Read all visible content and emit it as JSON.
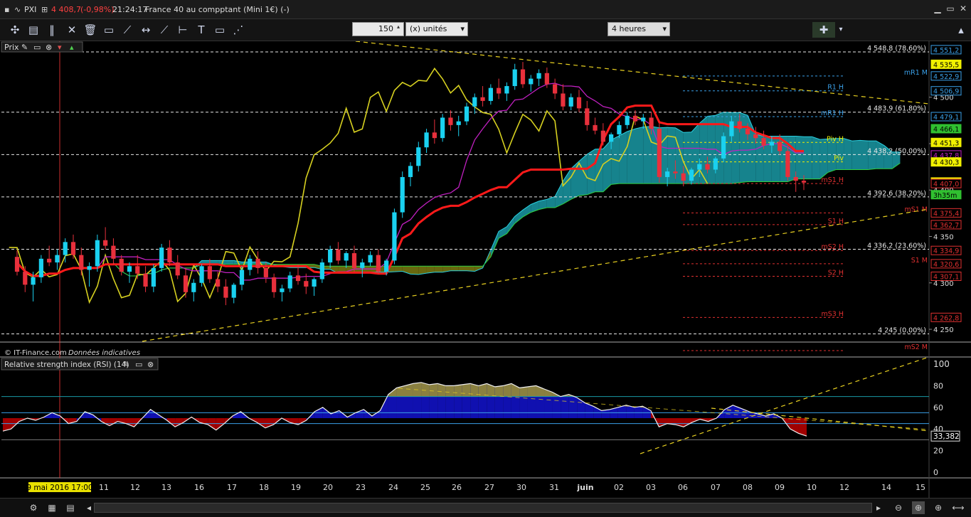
{
  "window": {
    "symbol": "PXI",
    "price": "4 408,7",
    "change": "(-0,98%)",
    "time": "21:24:17",
    "instrument": "France 40 au compptant (Mini 1€) (-)"
  },
  "toolbar": {
    "units_value": "150",
    "units_label": "(x) unités",
    "period_label": "4 heures"
  },
  "price_panel": {
    "label": "Prix",
    "source_label": "© IT-Finance.com",
    "source_note": "Données indicatives"
  },
  "rsi_panel": {
    "label": "Relative strength index (RSI) (14)",
    "value_tag": "33,382"
  },
  "colors": {
    "bull": "#1ad1f0",
    "bear": "#e8303c",
    "kijun": "#ff1a1a",
    "tenkan": "#c020c0",
    "chikou": "#d6d020",
    "cloud_bear": "#7a7a10",
    "cloud_bull": "#1a9aa6",
    "rsi_high": "#1010b0",
    "rsi_low": "#a00000"
  },
  "chart_data": {
    "type": "candlestick",
    "price_axis_ticks": [
      "4 500",
      "4 450",
      "4 400",
      "4 350",
      "4 300",
      "4 250"
    ],
    "price_tags": [
      {
        "text": "4 551,2",
        "price": 4551.2,
        "color": "#3aa0e8"
      },
      {
        "text": "4 535,5",
        "price": 4535.5,
        "color": "#f0f000"
      },
      {
        "text": "4 522,9",
        "price": 4522.9,
        "color": "#3aa0e8"
      },
      {
        "text": "4 506,9",
        "price": 4506.9,
        "color": "#3aa0e8"
      },
      {
        "text": "4 479,1",
        "price": 4479.1,
        "color": "#3aa0e8"
      },
      {
        "text": "4 466,1",
        "price": 4466.1,
        "color": "#30c030"
      },
      {
        "text": "4 451,3",
        "price": 4451.3,
        "color": "#f0f000"
      },
      {
        "text": "4 437,8",
        "price": 4437.8,
        "color": "#c020c0"
      },
      {
        "text": "4 430,3",
        "price": 4430.3,
        "color": "#f0f000"
      },
      {
        "text": "4 408,7",
        "price": 4408.7,
        "color": "#f0e000"
      },
      {
        "text": "4 407,0",
        "price": 4407.0,
        "color": "#e03030"
      },
      {
        "text": "3h35m",
        "price": 4395.0,
        "color": "#30c030"
      },
      {
        "text": "4 375,4",
        "price": 4375.4,
        "color": "#e03030"
      },
      {
        "text": "4 362,7",
        "price": 4362.7,
        "color": "#e03030"
      },
      {
        "text": "4 334,9",
        "price": 4334.9,
        "color": "#e03030"
      },
      {
        "text": "4 320,6",
        "price": 4320.6,
        "color": "#e03030"
      },
      {
        "text": "4 307,1",
        "price": 4307.1,
        "color": "#e03030"
      },
      {
        "text": "4 262,8",
        "price": 4262.8,
        "color": "#e03030"
      }
    ],
    "fibo_levels": [
      {
        "label": "4 548,8 (78,60%)",
        "price": 4548.8
      },
      {
        "label": "4 483,9 (61,80%)",
        "price": 4483.9
      },
      {
        "label": "4 438,2 (50,00%)",
        "price": 4438.2
      },
      {
        "label": "4 392,6 (38,20%)",
        "price": 4392.6
      },
      {
        "label": "4 336,2 (23,60%)",
        "price": 4336.2
      },
      {
        "label": "4 245 (0,00%)",
        "price": 4245.0
      }
    ],
    "pivot_levels": [
      {
        "label": "mR1 M",
        "price": 4522.9,
        "color": "#3aa0e8"
      },
      {
        "label": "R1 H",
        "price": 4506.9,
        "color": "#3aa0e8"
      },
      {
        "label": "mR1 H",
        "price": 4479.1,
        "color": "#3aa0e8"
      },
      {
        "label": "Piv H",
        "price": 4451.3,
        "color": "#f0f000"
      },
      {
        "label": "Piv",
        "price": 4430.3,
        "color": "#f0f000"
      },
      {
        "label": "mS1 H",
        "price": 4407.0,
        "color": "#e03030"
      },
      {
        "label": "mS1 M",
        "price": 4375.4,
        "color": "#e03030"
      },
      {
        "label": "S1 H",
        "price": 4362.7,
        "color": "#e03030"
      },
      {
        "label": "mS2 H",
        "price": 4334.9,
        "color": "#e03030"
      },
      {
        "label": "S1 M",
        "price": 4320.6,
        "color": "#e03030"
      },
      {
        "label": "S2 H",
        "price": 4307.1,
        "color": "#e03030"
      },
      {
        "label": "mS3 H",
        "price": 4262.8,
        "color": "#e03030"
      },
      {
        "label": "mS2 M",
        "price": 4227.0,
        "color": "#e03030"
      }
    ],
    "x_labels": [
      "9 mai 2016 17:00",
      "11",
      "12",
      "13",
      "16",
      "17",
      "18",
      "19",
      "20",
      "23",
      "24",
      "25",
      "26",
      "27",
      "30",
      "31",
      "juin",
      "02",
      "03",
      "06",
      "07",
      "08",
      "09",
      "10",
      "12",
      "14",
      "15"
    ],
    "candles": [
      [
        4328,
        4335,
        4308,
        4312
      ],
      [
        4312,
        4318,
        4290,
        4298
      ],
      [
        4298,
        4312,
        4280,
        4306
      ],
      [
        4306,
        4330,
        4300,
        4326
      ],
      [
        4326,
        4340,
        4318,
        4322
      ],
      [
        4322,
        4336,
        4314,
        4330
      ],
      [
        4330,
        4348,
        4322,
        4344
      ],
      [
        4344,
        4352,
        4326,
        4330
      ],
      [
        4330,
        4338,
        4308,
        4314
      ],
      [
        4314,
        4322,
        4296,
        4318
      ],
      [
        4318,
        4352,
        4312,
        4346
      ],
      [
        4346,
        4360,
        4336,
        4340
      ],
      [
        4340,
        4348,
        4320,
        4326
      ],
      [
        4326,
        4330,
        4308,
        4312
      ],
      [
        4312,
        4322,
        4300,
        4318
      ],
      [
        4318,
        4330,
        4304,
        4310
      ],
      [
        4310,
        4318,
        4290,
        4296
      ],
      [
        4296,
        4320,
        4290,
        4316
      ],
      [
        4316,
        4342,
        4312,
        4338
      ],
      [
        4338,
        4346,
        4318,
        4322
      ],
      [
        4322,
        4330,
        4304,
        4308
      ],
      [
        4308,
        4316,
        4284,
        4290
      ],
      [
        4290,
        4304,
        4280,
        4300
      ],
      [
        4300,
        4320,
        4296,
        4318
      ],
      [
        4318,
        4326,
        4300,
        4304
      ],
      [
        4304,
        4312,
        4290,
        4296
      ],
      [
        4296,
        4304,
        4276,
        4284
      ],
      [
        4284,
        4300,
        4278,
        4298
      ],
      [
        4298,
        4318,
        4292,
        4314
      ],
      [
        4314,
        4330,
        4308,
        4326
      ],
      [
        4326,
        4334,
        4310,
        4316
      ],
      [
        4316,
        4322,
        4300,
        4306
      ],
      [
        4306,
        4310,
        4284,
        4290
      ],
      [
        4290,
        4298,
        4280,
        4294
      ],
      [
        4294,
        4312,
        4290,
        4308
      ],
      [
        4308,
        4320,
        4298,
        4302
      ],
      [
        4302,
        4310,
        4288,
        4296
      ],
      [
        4296,
        4306,
        4286,
        4304
      ],
      [
        4304,
        4326,
        4300,
        4322
      ],
      [
        4322,
        4340,
        4316,
        4336
      ],
      [
        4336,
        4344,
        4320,
        4324
      ],
      [
        4324,
        4334,
        4316,
        4332
      ],
      [
        4332,
        4340,
        4312,
        4316
      ],
      [
        4316,
        4326,
        4306,
        4322
      ],
      [
        4322,
        4334,
        4318,
        4330
      ],
      [
        4330,
        4336,
        4310,
        4312
      ],
      [
        4312,
        4326,
        4308,
        4324
      ],
      [
        4324,
        4380,
        4320,
        4376
      ],
      [
        4376,
        4420,
        4370,
        4414
      ],
      [
        4414,
        4430,
        4404,
        4426
      ],
      [
        4426,
        4452,
        4420,
        4446
      ],
      [
        4446,
        4466,
        4440,
        4462
      ],
      [
        4462,
        4476,
        4450,
        4456
      ],
      [
        4456,
        4482,
        4452,
        4478
      ],
      [
        4478,
        4486,
        4464,
        4470
      ],
      [
        4470,
        4480,
        4458,
        4474
      ],
      [
        4474,
        4494,
        4470,
        4490
      ],
      [
        4490,
        4504,
        4482,
        4500
      ],
      [
        4500,
        4512,
        4490,
        4496
      ],
      [
        4496,
        4514,
        4492,
        4510
      ],
      [
        4510,
        4520,
        4498,
        4504
      ],
      [
        4504,
        4516,
        4496,
        4512
      ],
      [
        4512,
        4536,
        4508,
        4530
      ],
      [
        4530,
        4538,
        4510,
        4514
      ],
      [
        4514,
        4524,
        4506,
        4520
      ],
      [
        4520,
        4530,
        4512,
        4526
      ],
      [
        4526,
        4532,
        4510,
        4514
      ],
      [
        4514,
        4520,
        4498,
        4504
      ],
      [
        4504,
        4514,
        4486,
        4490
      ],
      [
        4490,
        4504,
        4486,
        4500
      ],
      [
        4500,
        4508,
        4484,
        4488
      ],
      [
        4488,
        4496,
        4464,
        4470
      ],
      [
        4470,
        4478,
        4460,
        4464
      ],
      [
        4464,
        4472,
        4448,
        4452
      ],
      [
        4452,
        4462,
        4444,
        4460
      ],
      [
        4460,
        4474,
        4456,
        4470
      ],
      [
        4470,
        4484,
        4466,
        4480
      ],
      [
        4480,
        4486,
        4470,
        4474
      ],
      [
        4474,
        4482,
        4466,
        4478
      ],
      [
        4478,
        4484,
        4460,
        4466
      ],
      [
        4466,
        4472,
        4408,
        4414
      ],
      [
        4414,
        4424,
        4404,
        4420
      ],
      [
        4420,
        4432,
        4412,
        4418
      ],
      [
        4418,
        4426,
        4404,
        4410
      ],
      [
        4410,
        4424,
        4406,
        4422
      ],
      [
        4422,
        4434,
        4414,
        4428
      ],
      [
        4428,
        4436,
        4418,
        4422
      ],
      [
        4422,
        4436,
        4418,
        4434
      ],
      [
        4434,
        4462,
        4430,
        4458
      ],
      [
        4458,
        4480,
        4452,
        4474
      ],
      [
        4474,
        4482,
        4462,
        4466
      ],
      [
        4466,
        4472,
        4454,
        4460
      ],
      [
        4460,
        4468,
        4450,
        4456
      ],
      [
        4456,
        4464,
        4444,
        4448
      ],
      [
        4448,
        4458,
        4440,
        4452
      ],
      [
        4452,
        4460,
        4438,
        4442
      ],
      [
        4442,
        4448,
        4410,
        4414
      ],
      [
        4414,
        4420,
        4398,
        4410
      ],
      [
        4410,
        4416,
        4400,
        4408
      ]
    ],
    "rsi_axis_ticks": [
      "100",
      "80",
      "60",
      "40",
      "20",
      "0"
    ],
    "rsi_values": [
      38,
      40,
      47,
      50,
      48,
      51,
      55,
      52,
      45,
      47,
      56,
      53,
      47,
      43,
      47,
      45,
      42,
      50,
      58,
      53,
      48,
      42,
      46,
      51,
      46,
      44,
      39,
      45,
      52,
      56,
      50,
      46,
      41,
      44,
      50,
      46,
      44,
      48,
      56,
      60,
      54,
      57,
      51,
      55,
      58,
      52,
      57,
      72,
      78,
      80,
      82,
      83,
      81,
      82,
      80,
      80,
      81,
      82,
      80,
      82,
      79,
      80,
      82,
      78,
      79,
      80,
      77,
      74,
      70,
      72,
      69,
      64,
      61,
      57,
      58,
      60,
      62,
      60,
      61,
      57,
      42,
      45,
      44,
      42,
      46,
      49,
      47,
      50,
      58,
      62,
      59,
      56,
      54,
      52,
      54,
      50,
      40,
      36,
      33.4
    ],
    "rsi_levels": [
      70,
      55,
      45,
      30
    ]
  }
}
